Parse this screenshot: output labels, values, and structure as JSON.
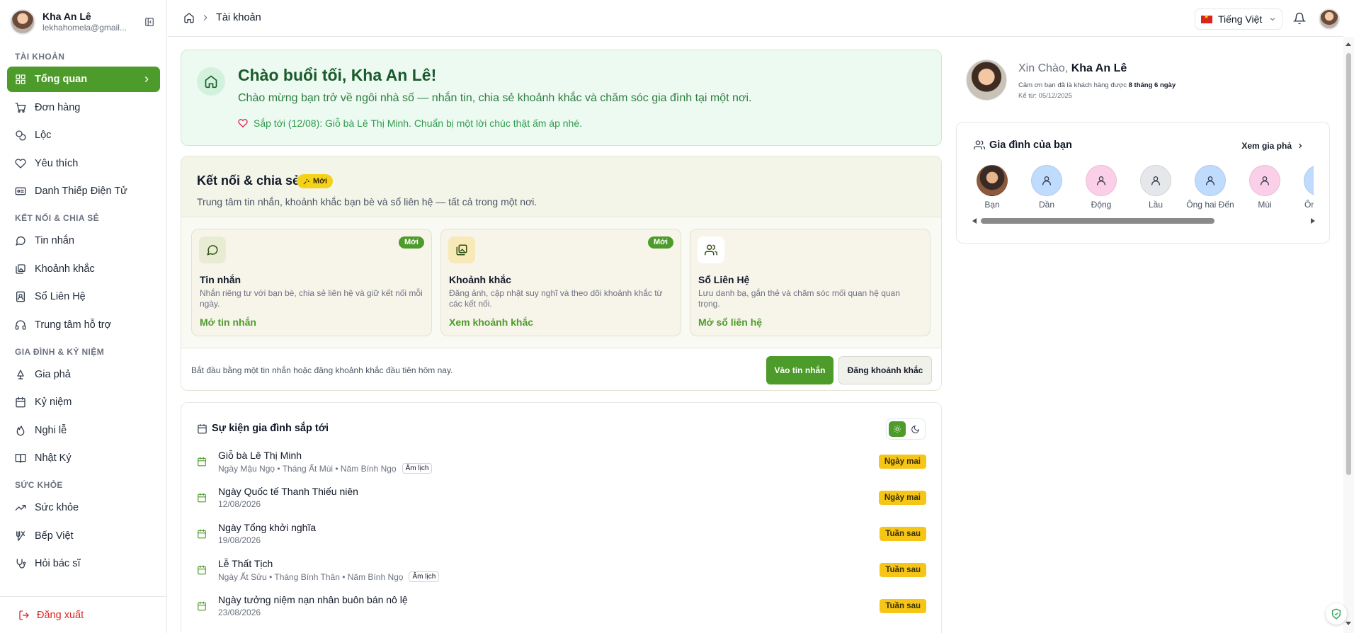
{
  "user": {
    "name": "Kha An Lê",
    "email": "lekhahomela@gmail..."
  },
  "sidebar": {
    "sections": [
      {
        "title": "TÀI KHOẢN",
        "items": [
          {
            "label": "Tổng quan",
            "icon": "grid-icon",
            "active": true
          },
          {
            "label": "Đơn hàng",
            "icon": "cart-icon"
          },
          {
            "label": "Lộc",
            "icon": "coin-icon"
          },
          {
            "label": "Yêu thích",
            "icon": "heart-icon"
          },
          {
            "label": "Danh Thiếp Điện Tử",
            "icon": "id-card-icon"
          }
        ]
      },
      {
        "title": "KẾT NỐI & CHIA SẺ",
        "items": [
          {
            "label": "Tin nhắn",
            "icon": "chat-icon"
          },
          {
            "label": "Khoảnh khắc",
            "icon": "gallery-icon"
          },
          {
            "label": "Sổ Liên Hệ",
            "icon": "contact-book-icon"
          },
          {
            "label": "Trung tâm hỗ trợ",
            "icon": "headset-icon"
          }
        ]
      },
      {
        "title": "GIA ĐÌNH & KỶ NIỆM",
        "items": [
          {
            "label": "Gia phả",
            "icon": "tree-icon"
          },
          {
            "label": "Kỷ niệm",
            "icon": "calendar-icon"
          },
          {
            "label": "Nghi lễ",
            "icon": "flame-icon"
          },
          {
            "label": "Nhật Ký",
            "icon": "book-icon"
          }
        ]
      },
      {
        "title": "SỨC KHỎE",
        "items": [
          {
            "label": "Sức khỏe",
            "icon": "trend-icon"
          },
          {
            "label": "Bếp Việt",
            "icon": "utensils-icon"
          },
          {
            "label": "Hỏi bác sĩ",
            "icon": "stethoscope-icon"
          }
        ]
      }
    ],
    "logout": "Đăng xuất"
  },
  "header": {
    "breadcrumb": "Tài khoản",
    "language": "Tiếng Việt"
  },
  "welcome": {
    "title": "Chào buổi tối, Kha An Lê!",
    "subtitle": "Chào mừng bạn trở về ngôi nhà số — nhắn tin, chia sẻ khoảnh khắc và chăm sóc gia đình tại một nơi.",
    "reminder": "Sắp tới (12/08): Giỗ bà Lê Thị Minh. Chuẩn bị một lời chúc thật ấm áp nhé."
  },
  "connect": {
    "title": "Kết nối & chia sẻ",
    "badge": "Mới",
    "description": "Trung tâm tin nhắn, khoảnh khắc bạn bè và sổ liên hệ — tất cả trong một nơi.",
    "cards": [
      {
        "title": "Tin nhắn",
        "desc": "Nhắn riêng tư với bạn bè, chia sẻ liên hệ và giữ kết nối mỗi ngày.",
        "link": "Mở tin nhắn",
        "badge": "Mới",
        "bg": "#e7ecd3"
      },
      {
        "title": "Khoảnh khắc",
        "desc": "Đăng ảnh, cập nhật suy nghĩ và theo dõi khoảnh khắc từ các kết nối.",
        "link": "Xem khoảnh khắc",
        "badge": "Mới",
        "bg": "#f7e9b8"
      },
      {
        "title": "Sổ Liên Hệ",
        "desc": "Lưu danh bạ, gắn thẻ và chăm sóc mối quan hệ quan trọng.",
        "link": "Mở sổ liên hệ",
        "badge": "",
        "bg": "#ffffff"
      }
    ],
    "footer_text": "Bắt đầu bằng một tin nhắn hoặc đăng khoảnh khắc đầu tiên hôm nay.",
    "primary_button": "Vào tin nhắn",
    "secondary_button": "Đăng khoảnh khắc"
  },
  "events": {
    "title": "Sự kiện gia đình sắp tới",
    "items": [
      {
        "title": "Giỗ bà Lê Thị Minh",
        "meta": "Ngày Mậu Ngọ • Tháng Ất Mùi • Năm Bính Ngọ",
        "lunar": "Âm lịch",
        "badge": "Ngày mai"
      },
      {
        "title": "Ngày Quốc tế Thanh Thiếu niên",
        "meta": "12/08/2026",
        "lunar": "",
        "badge": "Ngày mai"
      },
      {
        "title": "Ngày Tổng khởi nghĩa",
        "meta": "19/08/2026",
        "lunar": "",
        "badge": "Tuần sau"
      },
      {
        "title": "Lễ Thất Tịch",
        "meta": "Ngày Ất Sửu • Tháng Bính Thân • Năm Bính Ngọ",
        "lunar": "Âm lịch",
        "badge": "Tuần sau"
      },
      {
        "title": "Ngày tưởng niệm nạn nhân buôn bán nô lệ",
        "meta": "23/08/2026",
        "lunar": "",
        "badge": "Tuần sau"
      }
    ]
  },
  "profile": {
    "greeting": "Xin Chào,",
    "name": "Kha An Lê",
    "thanks": "Cảm ơn bạn đã là khách hàng được",
    "duration": "8 tháng 6 ngày",
    "since": "Kể từ: 05/12/2025"
  },
  "family": {
    "title": "Gia đình của bạn",
    "link": "Xem gia phả",
    "members": [
      {
        "name": "Bạn",
        "color": "#6b4a3a"
      },
      {
        "name": "Dần",
        "color": "#bfdbfe"
      },
      {
        "name": "Động",
        "color": "#fbcfe8"
      },
      {
        "name": "Lầu",
        "color": "#e5e7eb"
      },
      {
        "name": "Ông hai Đến",
        "color": "#bfdbfe"
      },
      {
        "name": "Mùi",
        "color": "#fbcfe8"
      },
      {
        "name": "Ông Sơ",
        "color": "#bfdbfe"
      }
    ]
  }
}
